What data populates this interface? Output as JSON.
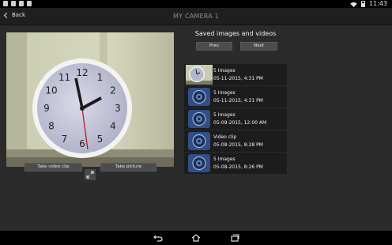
{
  "status": {
    "time": "11:43"
  },
  "header": {
    "back_label": "Back",
    "title": "MY CAMERA 1"
  },
  "controls": {
    "take_video_label": "Take video clip",
    "take_picture_label": "Take picture"
  },
  "saved": {
    "title": "Saved images and videos",
    "prev_label": "Prev",
    "next_label": "Next",
    "items": [
      {
        "title": "5 Images",
        "date": "05-11-2015, 4:31 PM",
        "thumb": "photo"
      },
      {
        "title": "5 Images",
        "date": "05-11-2015, 4:31 PM",
        "thumb": "camera-icon"
      },
      {
        "title": "5 Images",
        "date": "05-09-2015, 12:00 AM",
        "thumb": "camera-icon"
      },
      {
        "title": "Video clip",
        "date": "05-08-2015, 8:28 PM",
        "thumb": "camera-icon"
      },
      {
        "title": "5 Images",
        "date": "05-08-2015, 8:26 PM",
        "thumb": "camera-icon"
      }
    ]
  },
  "clock": {
    "numerals": [
      "12",
      "1",
      "2",
      "3",
      "4",
      "5",
      "6",
      "7",
      "8",
      "9",
      "10",
      "11"
    ]
  },
  "colors": {
    "app_bg": "#2b2b2b",
    "list_item_bg": "#1c1c1c",
    "icon_blue": "#2f4f86"
  }
}
